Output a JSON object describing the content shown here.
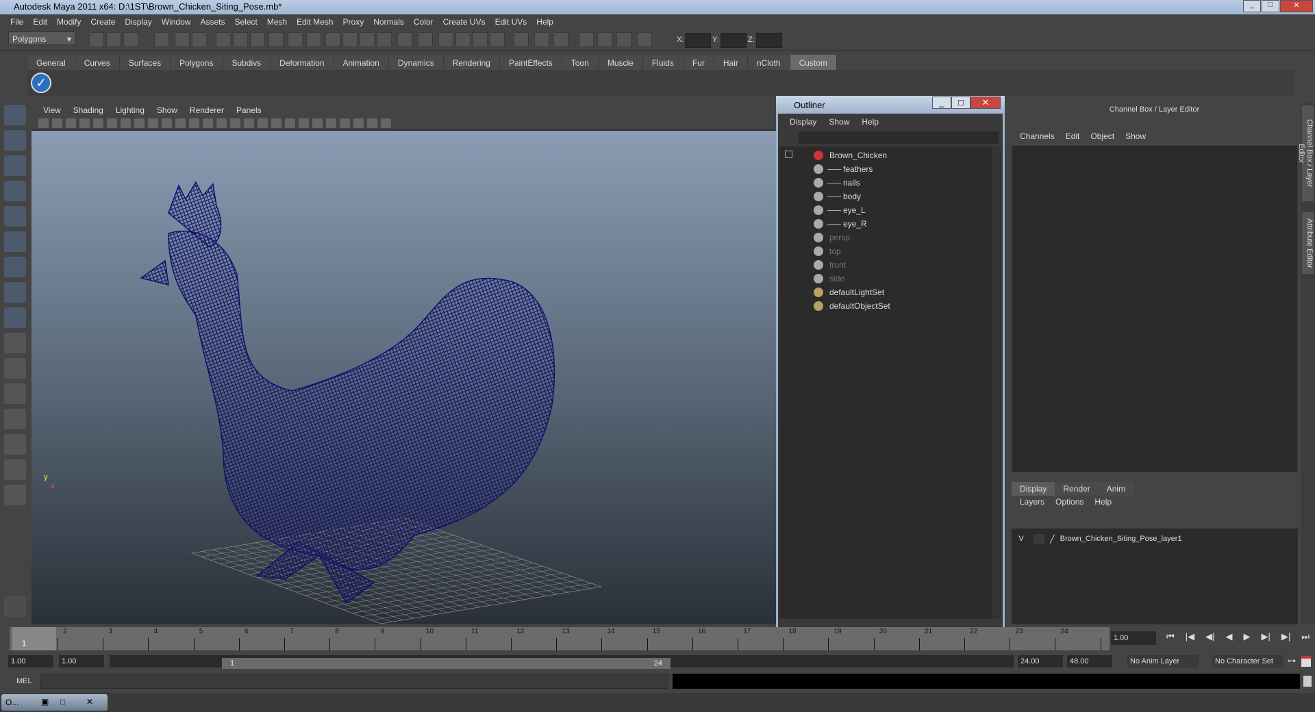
{
  "window": {
    "title": "Autodesk Maya 2011 x64: D:\\1ST\\Brown_Chicken_Siting_Pose.mb*"
  },
  "menubar": [
    "File",
    "Edit",
    "Modify",
    "Create",
    "Display",
    "Window",
    "Assets",
    "Select",
    "Mesh",
    "Edit Mesh",
    "Proxy",
    "Normals",
    "Color",
    "Create UVs",
    "Edit UVs",
    "Help"
  ],
  "toolbar": {
    "mode": "Polygons",
    "x_label": "X:",
    "y_label": "Y:",
    "z_label": "Z:"
  },
  "shelf": {
    "tabs": [
      "General",
      "Curves",
      "Surfaces",
      "Polygons",
      "Subdivs",
      "Deformation",
      "Animation",
      "Dynamics",
      "Rendering",
      "PaintEffects",
      "Toon",
      "Muscle",
      "Fluids",
      "Fur",
      "Hair",
      "nCloth",
      "Custom"
    ],
    "active": "Custom"
  },
  "viewport": {
    "menu": [
      "View",
      "Shading",
      "Lighting",
      "Show",
      "Renderer",
      "Panels"
    ],
    "axis_y": "y",
    "axis_x": "x",
    "wire_color": "#10106e"
  },
  "outliner": {
    "title": "Outliner",
    "menu": [
      "Display",
      "Show",
      "Help"
    ],
    "items": [
      {
        "name": "Brown_Chicken",
        "type": "group",
        "depth": 0
      },
      {
        "name": "feathers",
        "type": "mesh",
        "depth": 1
      },
      {
        "name": "nails",
        "type": "mesh",
        "depth": 1
      },
      {
        "name": "body",
        "type": "mesh",
        "depth": 1
      },
      {
        "name": "eye_L",
        "type": "mesh",
        "depth": 1
      },
      {
        "name": "eye_R",
        "type": "mesh",
        "depth": 1
      },
      {
        "name": "persp",
        "type": "camera",
        "depth": 0
      },
      {
        "name": "top",
        "type": "camera",
        "depth": 0
      },
      {
        "name": "front",
        "type": "camera",
        "depth": 0
      },
      {
        "name": "side",
        "type": "camera",
        "depth": 0
      },
      {
        "name": "defaultLightSet",
        "type": "set",
        "depth": 0
      },
      {
        "name": "defaultObjectSet",
        "type": "set",
        "depth": 0
      }
    ]
  },
  "channelbox": {
    "title": "Channel Box / Layer Editor",
    "menu": [
      "Channels",
      "Edit",
      "Object",
      "Show"
    ],
    "layer_tabs": [
      "Display",
      "Render",
      "Anim"
    ],
    "layer_menu": [
      "Layers",
      "Options",
      "Help"
    ],
    "layer": {
      "visible": "V",
      "name": "Brown_Chicken_Siting_Pose_layer1"
    }
  },
  "side_tabs": [
    "Channel Box / Layer Editor",
    "Attribute Editor"
  ],
  "timeline": {
    "ticks": [
      1,
      2,
      3,
      4,
      5,
      6,
      7,
      8,
      9,
      10,
      11,
      12,
      13,
      14,
      15,
      16,
      17,
      18,
      19,
      20,
      21,
      22,
      23,
      24
    ],
    "current": "1",
    "current_field": "1.00"
  },
  "range": {
    "start": "1.00",
    "playback_start": "1.00",
    "slider_start": "1",
    "slider_end": "24",
    "playback_end": "24.00",
    "end": "48.00",
    "anim_layer": "No Anim Layer",
    "char_set": "No Character Set"
  },
  "mel": {
    "label": "MEL"
  },
  "taskbar": {
    "item": "O..."
  }
}
